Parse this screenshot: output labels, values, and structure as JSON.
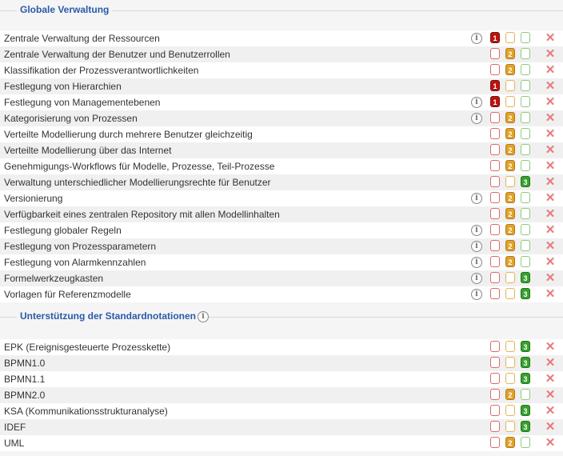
{
  "sections": [
    {
      "title": "Globale Verwaltung",
      "has_info": false,
      "rows": [
        {
          "label": "Zentrale Verwaltung der Ressourcen",
          "info": true,
          "level": 1
        },
        {
          "label": "Zentrale Verwaltung der Benutzer und Benutzerrollen",
          "info": false,
          "level": 2
        },
        {
          "label": "Klassifikation der Prozessverantwortlichkeiten",
          "info": false,
          "level": 2
        },
        {
          "label": "Festlegung von Hierarchien",
          "info": false,
          "level": 1
        },
        {
          "label": "Festlegung von Managementebenen",
          "info": true,
          "level": 1
        },
        {
          "label": "Kategorisierung von Prozessen",
          "info": true,
          "level": 2
        },
        {
          "label": "Verteilte Modellierung durch mehrere Benutzer gleichzeitig",
          "info": false,
          "level": 2
        },
        {
          "label": "Verteilte Modellierung über das Internet",
          "info": false,
          "level": 2
        },
        {
          "label": "Genehmigungs-Workflows für Modelle, Prozesse, Teil-Prozesse",
          "info": false,
          "level": 2
        },
        {
          "label": "Verwaltung unterschiedlicher Modellierungsrechte für Benutzer",
          "info": false,
          "level": 3
        },
        {
          "label": "Versionierung",
          "info": true,
          "level": 2
        },
        {
          "label": "Verfügbarkeit eines zentralen Repository mit allen Modellinhalten",
          "info": false,
          "level": 2
        },
        {
          "label": "Festlegung globaler Regeln",
          "info": true,
          "level": 2
        },
        {
          "label": "Festlegung von Prozessparametern",
          "info": true,
          "level": 2
        },
        {
          "label": "Festlegung von Alarmkennzahlen",
          "info": true,
          "level": 2
        },
        {
          "label": "Formelwerkzeugkasten",
          "info": true,
          "level": 3
        },
        {
          "label": "Vorlagen für Referenzmodelle",
          "info": true,
          "level": 3
        }
      ]
    },
    {
      "title": "Unterstützung der Standardnotationen",
      "has_info": true,
      "rows": [
        {
          "label": "EPK (Ereignisgesteuerte Prozesskette)",
          "info": false,
          "level": 3
        },
        {
          "label": "BPMN1.0",
          "info": false,
          "level": 3
        },
        {
          "label": "BPMN1.1",
          "info": false,
          "level": 3
        },
        {
          "label": "BPMN2.0",
          "info": false,
          "level": 2
        },
        {
          "label": "KSA (Kommunikationsstrukturanalyse)",
          "info": false,
          "level": 3
        },
        {
          "label": "IDEF",
          "info": false,
          "level": 3
        },
        {
          "label": "UML",
          "info": false,
          "level": 2
        }
      ]
    }
  ],
  "icons": {
    "info": "info-icon",
    "delete": "delete-x-icon"
  },
  "colors": {
    "level1": "#b81414",
    "level2": "#e2a12a",
    "level3": "#37a12b",
    "section_title": "#2b5aa8"
  }
}
